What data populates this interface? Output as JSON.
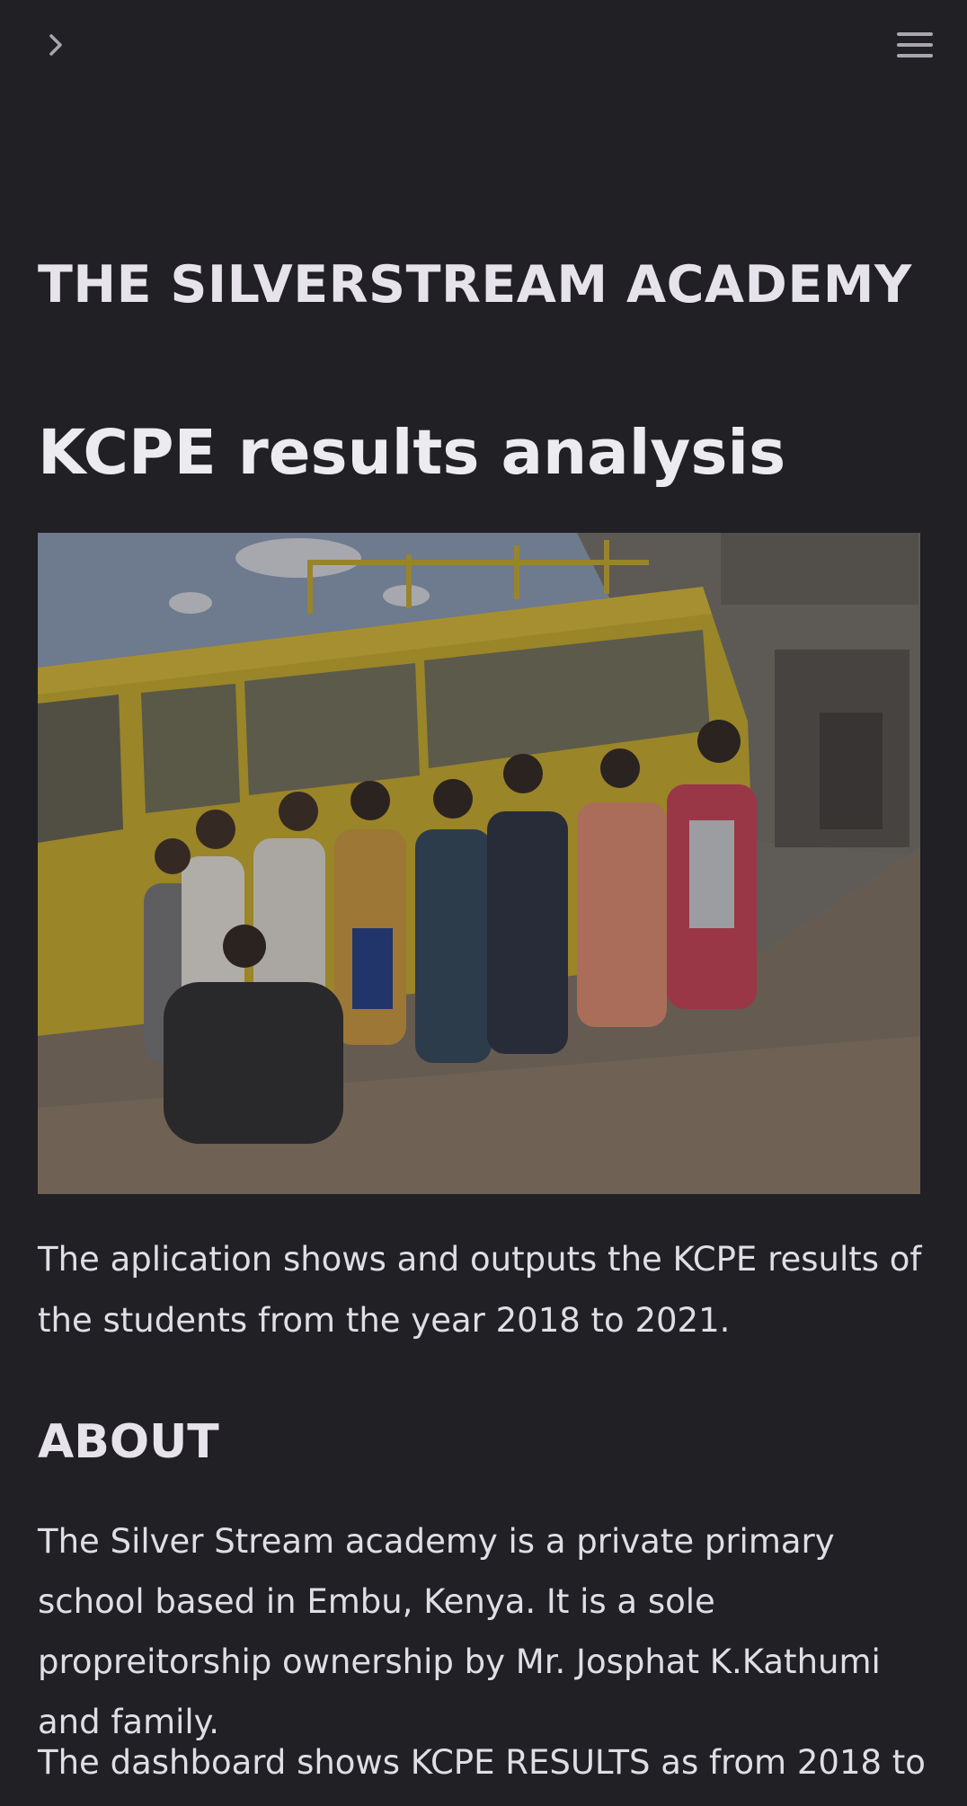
{
  "nav": {
    "sidebar_toggle_icon": "chevron-right-icon",
    "menu_icon": "hamburger-menu-icon"
  },
  "header": {
    "site_title": "THE SILVERSTREAM ACADEMY",
    "page_title": "KCPE results analysis"
  },
  "hero_image": {
    "subject": "group photo in front of yellow school bus"
  },
  "intro": {
    "text": "The aplication shows and outputs the KCPE results of the students from the year 2018 to 2021."
  },
  "about": {
    "heading": "ABOUT",
    "paragraph": "The Silver Stream academy is a private primary school based in Embu, Kenya. It is a sole propreitorship ownership by Mr. Josphat K.Kathumi and family.",
    "dashboard_text": "The dashboard shows KCPE RESULTS as from 2018 to"
  },
  "colors": {
    "background": "#212024",
    "text": "#e6e4ea",
    "icon": "#a9a7ad"
  }
}
